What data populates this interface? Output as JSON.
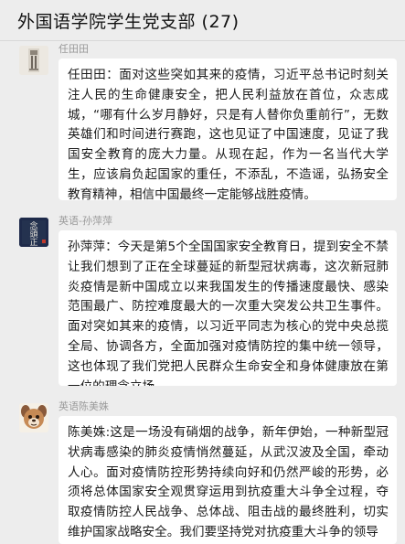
{
  "header": {
    "title": "外国语学院学生党支部 (27)"
  },
  "messages": [
    {
      "sender": "任田田",
      "avatar_icon": "ink-landscape-avatar",
      "text": "任田田：面对这些突如其来的疫情，习近平总书记时刻关注人民的生命健康安全，把人民利益放在首位，众志成城，“哪有什么岁月静好，只是有人替你负重前行”，无数英雄们和时间进行赛跑，这也见证了中国速度，见证了我国安全教育的庞大力量。从现在起，作为一名当代大学生，应该肩负起国家的重任，不添乱，不造谣，弘扬安全教育精神，相信中国最终一定能够战胜疫情。"
    },
    {
      "sender": "英语-孙萍萍",
      "avatar_icon": "calligraphy-avatar",
      "avatar_text": "念\n頭\n正",
      "text": "孙萍萍：今天是第5个全国国家安全教育日，提到安全不禁让我们想到了正在全球蔓延的新型冠状病毒，这次新冠肺炎疫情是新中国成立以来我国发生的传播速度最快、感染范围最广、防控难度最大的一次重大突发公共卫生事件。面对突如其来的疫情，以习近平同志为核心的党中央总揽全局、协调各方，全面加强对疫情防控的集中统一领导，这也体现了我们党把人民群众生命安全和身体健康放在第一位的理念立场。"
    },
    {
      "sender": "英语陈美姝",
      "avatar_icon": "cartoon-dog-avatar",
      "text": "陈美姝:这是一场没有硝烟的战争，新年伊始，一种新型冠状病毒感染的肺炎疫情悄然蔓延，从武汉波及全国，牵动人心。面对疫情防控形势持续向好和仍然严峻的形势，必须将总体国家安全观贯穿运用到抗疫重大斗争全过程，夺取疫情防控人民战争、总体战、阻击战的最终胜利，切实维护国家战略安全。我们要坚持党对抗疫重大斗争的领导"
    }
  ]
}
